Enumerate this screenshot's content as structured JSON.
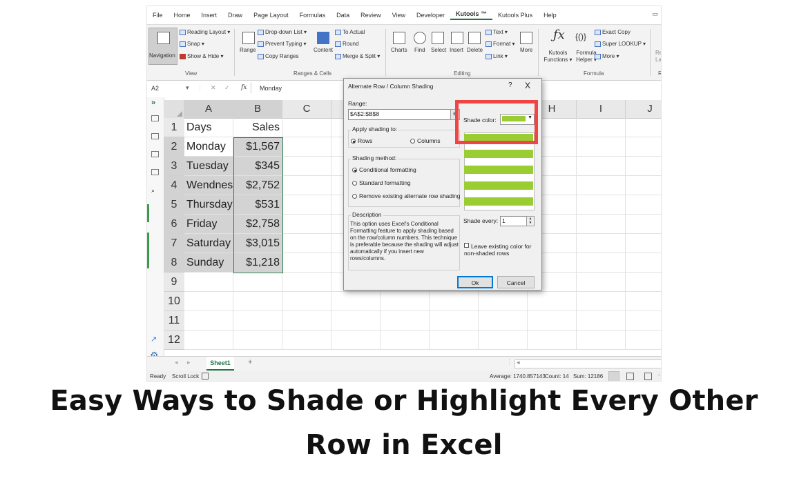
{
  "menubar": {
    "items": [
      "File",
      "Home",
      "Insert",
      "Draw",
      "Page Layout",
      "Formulas",
      "Data",
      "Review",
      "View",
      "Developer",
      "Kutools ™",
      "Kutools Plus",
      "Help"
    ],
    "active_index": 10
  },
  "ribbon": {
    "navigation": "Navigation",
    "view_items": [
      "Reading Layout ▾",
      "Snap ▾",
      "Show & Hide ▾"
    ],
    "view_group": "View",
    "range_label": "Range",
    "range_items": [
      "Drop-down List ▾",
      "Prevent Typing ▾",
      "Copy Ranges"
    ],
    "content_label": "Content",
    "content_items": [
      "To Actual",
      "Round",
      "Merge & Split ▾"
    ],
    "range_group": "Ranges & Cells",
    "editing_big": [
      "Charts",
      "Find",
      "Select",
      "Insert",
      "Delete",
      "More"
    ],
    "editing_small": [
      "Text ▾",
      "Format ▾",
      "Link ▾"
    ],
    "editing_group": "Editing",
    "formula_big": [
      "Kutools Functions ▾",
      "Formula Helper ▾"
    ],
    "formula_items": [
      "Exact Copy",
      "Super LOOKUP ▾",
      "More ▾"
    ],
    "formula_group": "Formula",
    "cut_off_label": "Re Las",
    "cut_off_group": "R"
  },
  "formula_bar": {
    "name_box": "A2",
    "fx": "fx",
    "value": "Monday"
  },
  "grid": {
    "columns": [
      "A",
      "B",
      "C",
      "D",
      "E",
      "F",
      "G",
      "H",
      "I",
      "J"
    ],
    "rows": [
      "1",
      "2",
      "3",
      "4",
      "5",
      "6",
      "7",
      "8",
      "9",
      "10",
      "11",
      "12"
    ],
    "header_row": {
      "a": "Days",
      "b": "Sales"
    },
    "data": [
      {
        "day": "Monday",
        "sales": "$1,567"
      },
      {
        "day": "Tuesday",
        "sales": "$345"
      },
      {
        "day": "Wendnesc",
        "sales": "$2,752"
      },
      {
        "day": "Thursday",
        "sales": "$531"
      },
      {
        "day": "Friday",
        "sales": "$2,758"
      },
      {
        "day": "Saturday",
        "sales": "$3,015"
      },
      {
        "day": "Sunday",
        "sales": "$1,218"
      }
    ]
  },
  "sheet_tabs": {
    "active": "Sheet1",
    "add": "+"
  },
  "status": {
    "ready": "Ready",
    "scroll_lock": "Scroll Lock",
    "average": "Average: 1740.857143",
    "count": "Count: 14",
    "sum": "Sum: 12186"
  },
  "dialog": {
    "title": "Alternate Row / Column Shading",
    "help": "?",
    "close": "X",
    "range_label": "Range:",
    "range_value": "$A$2:$B$8",
    "apply_label": "Apply shading to:",
    "rows": "Rows",
    "columns": "Columns",
    "method_label": "Shading method:",
    "methods": [
      "Conditional formatting",
      "Standard formatting",
      "Remove existing alternate row shading"
    ],
    "description_label": "Description",
    "description": "This option uses Excel's Conditional Formatting feature to apply shading based on the row/column numbers. This technique is preferable because the shading will adjust automatically if you insert new rows/columns.",
    "shade_color_label": "Shade color:",
    "shade_color": "#9acd32",
    "shade_every_label": "Shade every:",
    "shade_every_value": "1",
    "leave_existing": "Leave existing color for non-shaded rows",
    "ok": "Ok",
    "cancel": "Cancel"
  },
  "caption": {
    "line1": "Easy Ways to Shade or Highlight Every Other",
    "line2": "Row in Excel"
  },
  "colors": {
    "excel_green": "#217346",
    "highlight_red": "#f04545",
    "shade_green": "#9acd32"
  }
}
